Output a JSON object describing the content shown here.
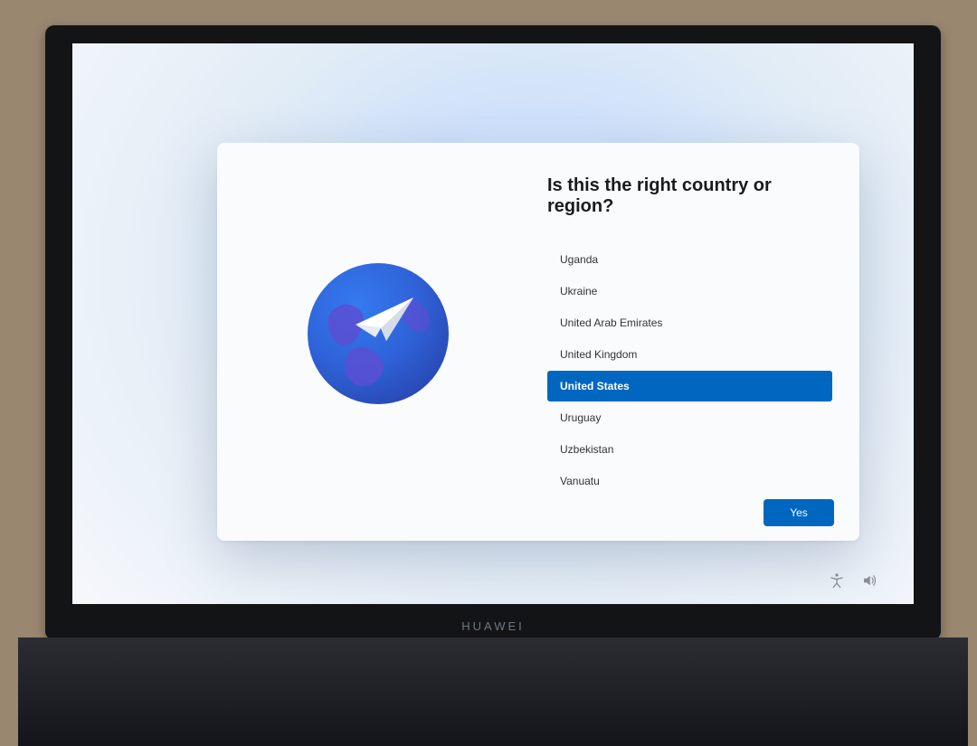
{
  "title": "Is this the right country or region?",
  "regions": [
    {
      "label": "Uganda",
      "selected": false
    },
    {
      "label": "Ukraine",
      "selected": false
    },
    {
      "label": "United Arab Emirates",
      "selected": false
    },
    {
      "label": "United Kingdom",
      "selected": false
    },
    {
      "label": "United States",
      "selected": true
    },
    {
      "label": "Uruguay",
      "selected": false
    },
    {
      "label": "Uzbekistan",
      "selected": false
    },
    {
      "label": "Vanuatu",
      "selected": false
    }
  ],
  "confirm_button_label": "Yes",
  "laptop_brand": "HUAWEI",
  "colors": {
    "accent": "#0067c0"
  }
}
